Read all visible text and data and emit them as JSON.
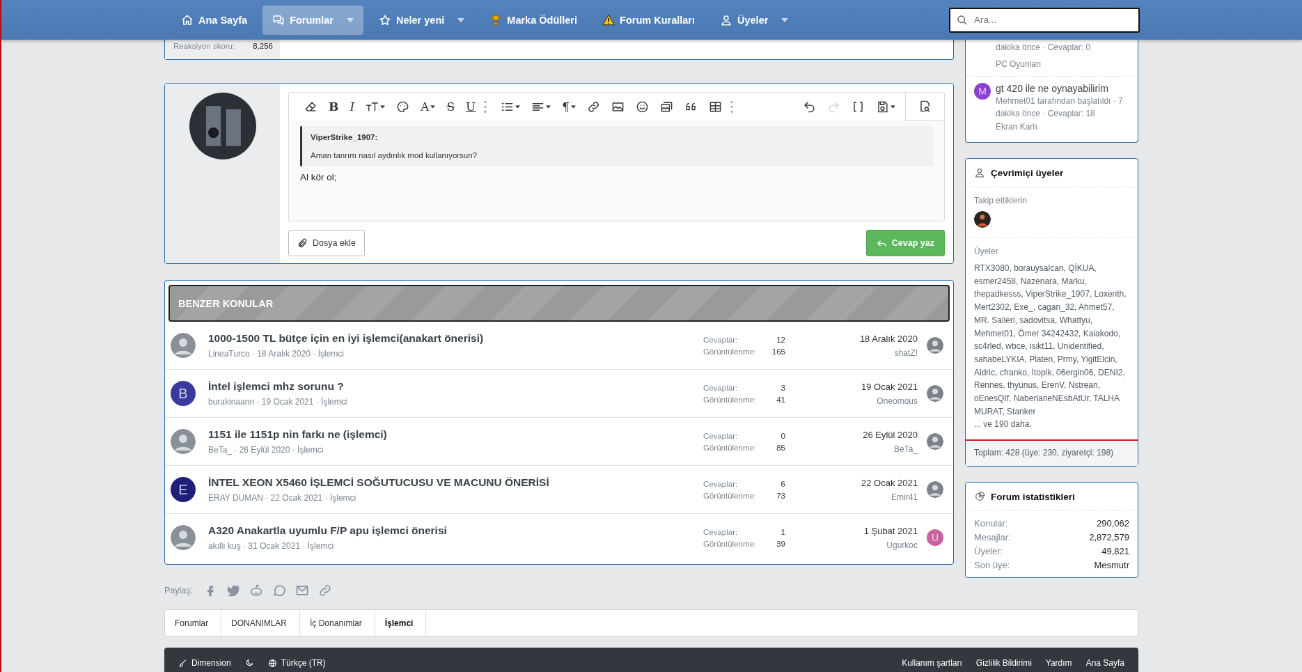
{
  "nav": {
    "items": [
      {
        "label": "Ana Sayfa",
        "selected": false,
        "caret": false
      },
      {
        "label": "Forumlar",
        "selected": true,
        "caret": true
      },
      {
        "label": "Neler yeni",
        "selected": false,
        "caret": true
      },
      {
        "label": "Marka Ödülleri",
        "selected": false,
        "caret": false
      },
      {
        "label": "Forum Kuralları",
        "selected": false,
        "caret": false
      },
      {
        "label": "Üyeler",
        "selected": false,
        "caret": true
      }
    ],
    "search": {
      "placeholder": "Ara..."
    }
  },
  "previous_post": {
    "stat_label": "Reaksiyon skoru:",
    "stat_value": "8,256"
  },
  "reply_editor": {
    "toolbar_left": [
      {
        "kind": "icon",
        "caret": false
      },
      {
        "kind": "bold",
        "glyph": "B",
        "caret": false
      },
      {
        "kind": "italic",
        "glyph": "I",
        "caret": false
      },
      {
        "kind": "icon",
        "caret": true
      },
      {
        "kind": "icon",
        "caret": false
      },
      {
        "kind": "letter",
        "glyph": "A",
        "caret": true
      },
      {
        "kind": "strike",
        "glyph": "S",
        "caret": false
      },
      {
        "kind": "underline",
        "glyph": "U",
        "caret": false
      },
      {
        "kind": "icon",
        "caret": false
      },
      {
        "kind": "icon",
        "caret": true
      },
      {
        "kind": "icon",
        "caret": true
      },
      {
        "kind": "letter",
        "glyph": "¶",
        "caret": true
      },
      {
        "kind": "icon",
        "caret": false
      },
      {
        "kind": "icon",
        "caret": false
      },
      {
        "kind": "icon",
        "caret": false
      },
      {
        "kind": "icon",
        "caret": false
      },
      {
        "kind": "icon",
        "caret": false
      },
      {
        "kind": "icon",
        "caret": false
      },
      {
        "kind": "icon",
        "caret": false
      }
    ],
    "toolbar_right": [
      {
        "caret": false,
        "disabled": false
      },
      {
        "caret": false,
        "disabled": true
      },
      {
        "caret": false,
        "disabled": false
      },
      {
        "caret": true,
        "disabled": false
      }
    ],
    "quote": {
      "author": "ViperStrike_1907:",
      "text": "Aman tanrım nasıl aydınlık mod kullanıyorsun?"
    },
    "value": "Al kör ol;",
    "attach_button": "Dosya ekle",
    "submit_button": "Cevap yaz"
  },
  "similar_threads": {
    "title": "BENZER KONULAR",
    "rows": [
      {
        "title": "1000-1500 TL bütçe için en iyi işlemci(anakart önerisi)",
        "meta": "LineaTurco · 18 Aralık 2020 · İşlemci",
        "replies_label": "Cevaplar:",
        "replies": "12",
        "views_label": "Görüntülenme:",
        "views": "165",
        "last_date": "18 Aralık 2020",
        "last_user": "shatZ!"
      },
      {
        "avatar": {
          "kind": "letter",
          "letter": "B",
          "color": "#3a3a9c"
        },
        "title": "İntel işlemci mhz sorunu ?",
        "meta": "burakinaann · 19 Ocak 2021 · İşlemci",
        "replies_label": "Cevaplar:",
        "replies": "3",
        "views_label": "Görüntülenme:",
        "views": "41",
        "last_date": "19 Ocak 2021",
        "last_user": "Oneomous"
      },
      {
        "title": "1151 ile 1151p nin farkı ne (işlemci)",
        "meta": "BeTa_ · 26 Eylül 2020 · İşlemci",
        "replies_label": "Cevaplar:",
        "replies": "0",
        "views_label": "Görüntülenme:",
        "views": "85",
        "last_date": "26 Eylül 2020",
        "last_user": "BeTa_"
      },
      {
        "avatar": {
          "kind": "letter",
          "letter": "E",
          "color": "#1f1f7a"
        },
        "title": "İNTEL XEON X5460 İŞLEMCİ SOĞUTUCUSU VE MACUNU ÖNERİSİ",
        "meta": "ERAY DUMAN · 22 Ocak 2021 · İşlemci",
        "replies_label": "Cevaplar:",
        "replies": "6",
        "views_label": "Görüntülenme:",
        "views": "73",
        "last_date": "22 Ocak 2021",
        "last_user": "Emir41"
      },
      {
        "title": "A320 Anakartla uyumlu F/P apu işlemci önerisi",
        "meta": "akıllı kuş · 31 Ocak 2021 · İşlemci",
        "replies_label": "Cevaplar:",
        "replies": "1",
        "views_label": "Görüntülenme:",
        "views": "39",
        "last_date": "1 Şubat 2021",
        "last_user": "Ugurkoc",
        "last_avatar": {
          "kind": "letter",
          "letter": "U",
          "color": "#c9619f"
        }
      }
    ]
  },
  "share": {
    "label": "Paylaş:"
  },
  "sidebar": {
    "latest": {
      "partial_meta": "dakika önce · Cevaplar: 0",
      "partial_forum": "PC Oyunları",
      "item": {
        "avatar": {
          "letter": "M",
          "color": "#8d3fd0"
        },
        "title": "gt 420 ile ne oynayabilirim",
        "meta": "Mehmet01 tarafından başlatıldı · 7 dakika önce · Cevaplar: 18",
        "forum": "Ekran Kartı"
      }
    },
    "online": {
      "title": "Çevrimiçi üyeler",
      "following_label": "Takip ettiklerin",
      "members_label": "Üyeler",
      "members": "RTX3080, borauysalcan, QİKUA, esmer2458, Nazenara, Marku, thepadkesss, ViperStrike_1907, Loxerith, Mert2302, Exe_, cagan_32, Ahmet57, MR. Salieri, sadovitsa, Whattyu, Mehmet01, Ömer 34242432, Kaiakodo, sc4rled, wbce, isikt11, Unidentified, sahabeLYKIA, Platen, Prmy, YigitElcin, Aldric, cfranko, İtopik, 06ergin06, DENI2, Rennes, thyunus, ErenV, Nstrean, oEnesQIf, NaberlaneNEsbAtUr, TALHA MURAT, Stanker",
      "more": "... ve 190 daha.",
      "total": "Toplam: 428 (üye: 230, ziyaretçi: 198)"
    },
    "stats": {
      "title": "Forum istatistikleri",
      "rows": [
        {
          "label": "Konular:",
          "value": "290,062"
        },
        {
          "label": "Mesajlar:",
          "value": "2,872,579"
        },
        {
          "label": "Üyeler:",
          "value": "49,821"
        },
        {
          "label": "Son üye:",
          "value": "Mesmutr"
        }
      ]
    }
  },
  "breadcrumb": [
    {
      "label": "Forumlar",
      "current": false
    },
    {
      "label": "DONANIMLAR",
      "current": false
    },
    {
      "label": "İç Donanımlar",
      "current": false
    },
    {
      "label": "İşlemci",
      "current": true
    }
  ],
  "footer": {
    "style_label": "Dimension",
    "language": "Türkçe (TR)",
    "links": [
      "Kullanım şartları",
      "Gizlilik Bildirimi",
      "Yardım",
      "Ana Sayfa"
    ]
  }
}
